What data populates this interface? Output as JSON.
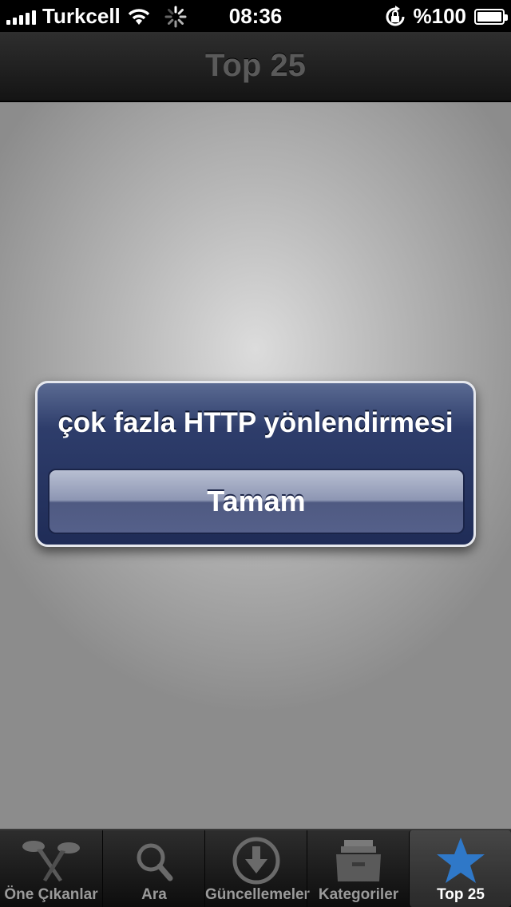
{
  "status_bar": {
    "carrier": "Turkcell",
    "time": "08:36",
    "battery": "%100"
  },
  "nav": {
    "title": "Top 25"
  },
  "alert": {
    "message": "çok fazla HTTP yönlendirmesi",
    "button_label": "Tamam"
  },
  "tab_bar": {
    "items": [
      {
        "label": "Öne Çıkanlar",
        "icon": "featured-icon"
      },
      {
        "label": "Ara",
        "icon": "search-icon"
      },
      {
        "label": "Güncellemeler",
        "icon": "updates-icon"
      },
      {
        "label": "Kategoriler",
        "icon": "categories-icon"
      },
      {
        "label": "Top 25",
        "icon": "star-icon"
      }
    ],
    "active_index": 4
  },
  "colors": {
    "alert_bg": "#1f2c57",
    "active_icon": "#2f78c8"
  }
}
